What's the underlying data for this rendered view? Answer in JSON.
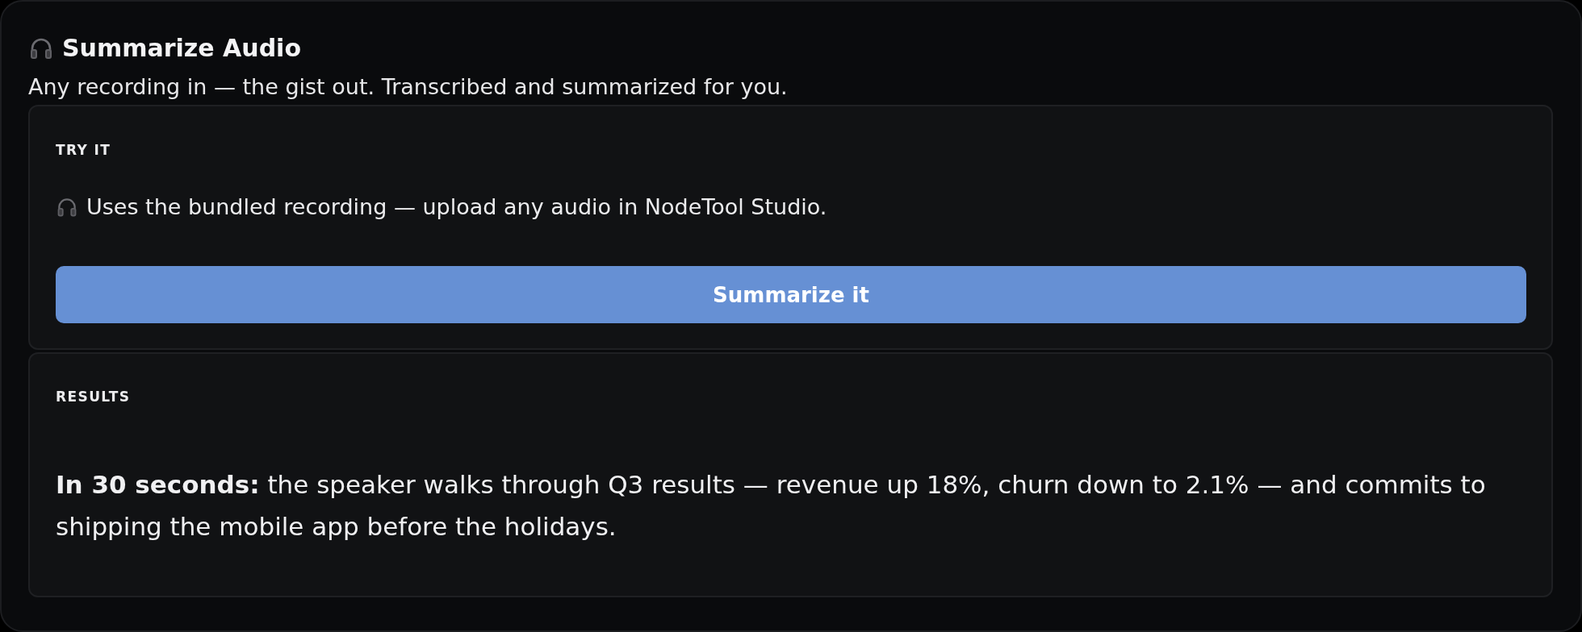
{
  "header": {
    "title": "Summarize Audio",
    "subtitle": "Any recording in — the gist out. Transcribed and summarized for you."
  },
  "try_it": {
    "heading": "TRY IT",
    "note": "Uses the bundled recording — upload any audio in NodeTool Studio.",
    "button": "Summarize it"
  },
  "results": {
    "heading": "RESULTS",
    "summary": "**In 30 seconds:** the speaker walks through Q3 results — revenue up 18%, churn down to 2.1% — and commits to shipping the mobile app before the holidays."
  }
}
